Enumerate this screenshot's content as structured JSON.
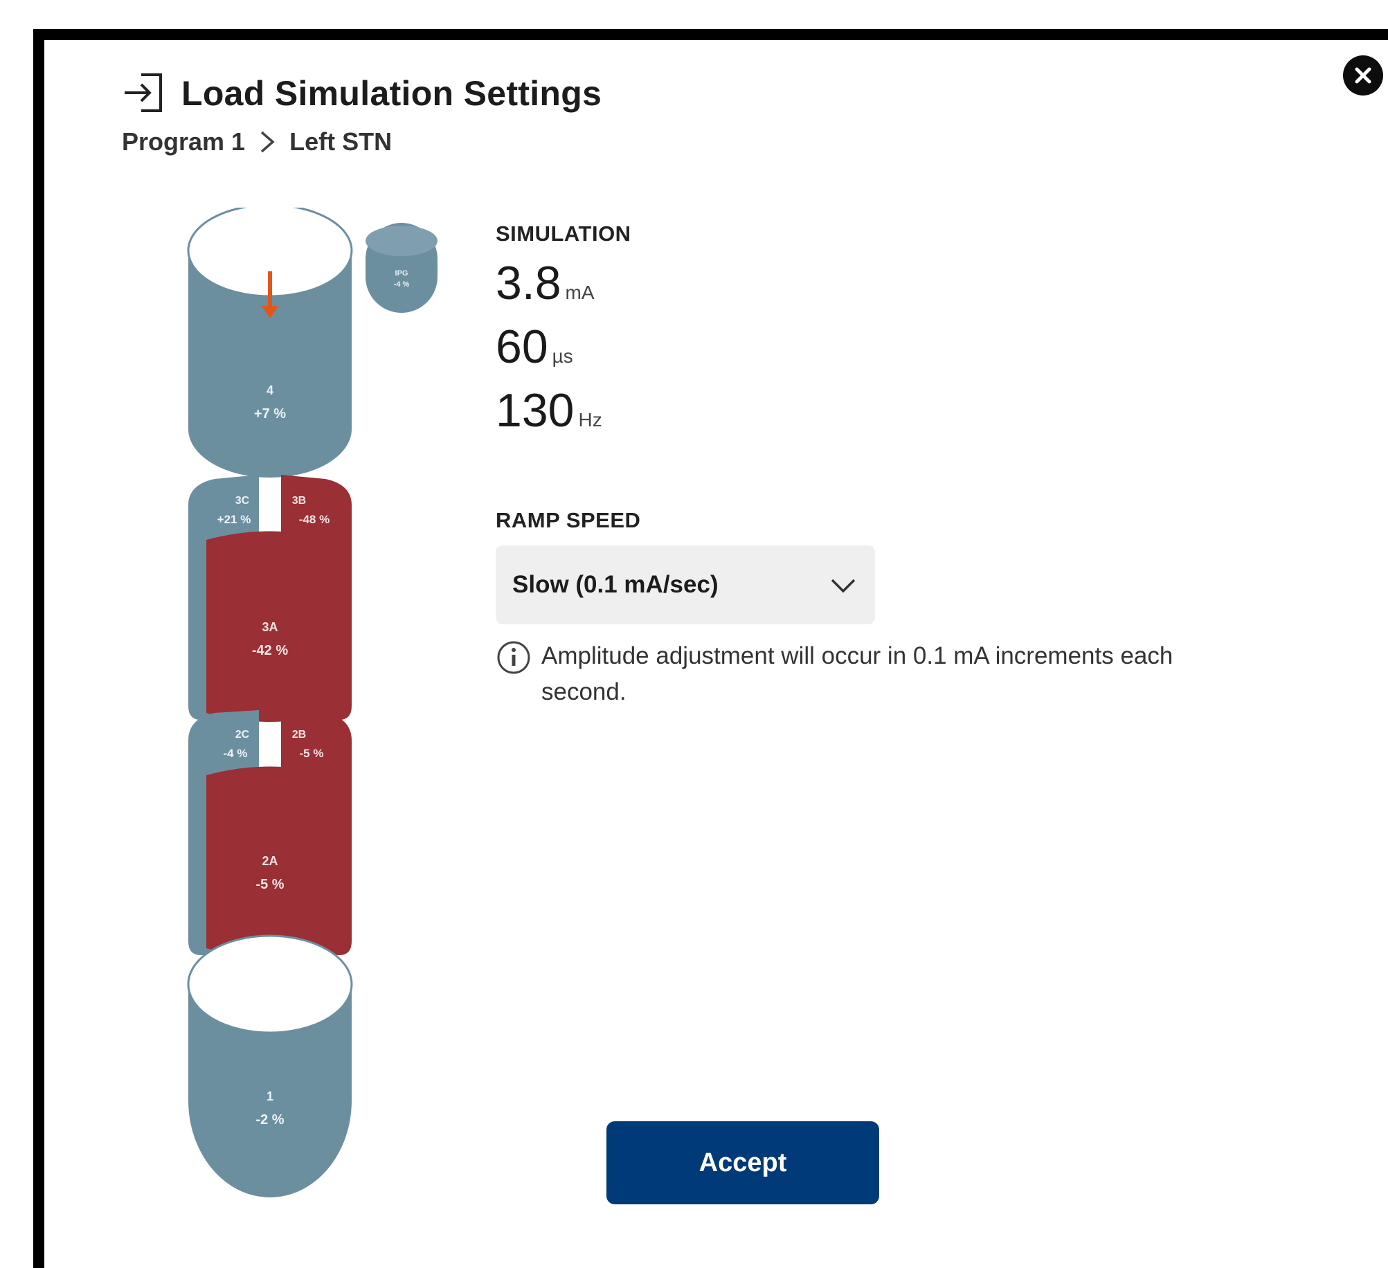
{
  "header": {
    "title": "Load Simulation Settings",
    "breadcrumb": [
      "Program 1",
      "Left STN"
    ]
  },
  "simulation": {
    "label": "SIMULATION",
    "amplitude": {
      "value": "3.8",
      "unit": "mA"
    },
    "pulse_width": {
      "value": "60",
      "unit": "µs"
    },
    "frequency": {
      "value": "130",
      "unit": "Hz"
    }
  },
  "ramp": {
    "label": "RAMP SPEED",
    "selected": "Slow (0.1 mA/sec)",
    "info": "Amplitude adjustment will occur in 0.1 mA increments each second."
  },
  "lead": {
    "contacts": [
      {
        "id": "4",
        "pct": "+7 %"
      },
      {
        "id": "3C",
        "pct": "+21 %"
      },
      {
        "id": "3B",
        "pct": "-48 %"
      },
      {
        "id": "3A",
        "pct": "-42 %"
      },
      {
        "id": "2C",
        "pct": "-4 %"
      },
      {
        "id": "2B",
        "pct": "-5 %"
      },
      {
        "id": "2A",
        "pct": "-5 %"
      },
      {
        "id": "1",
        "pct": "-2 %"
      }
    ],
    "can": {
      "id": "IPG",
      "pct": "-4 %"
    }
  },
  "colors": {
    "anode": "#6c8fa0",
    "cathode": "#9a2f35",
    "primary_button": "#003a78"
  },
  "actions": {
    "accept": "Accept"
  }
}
